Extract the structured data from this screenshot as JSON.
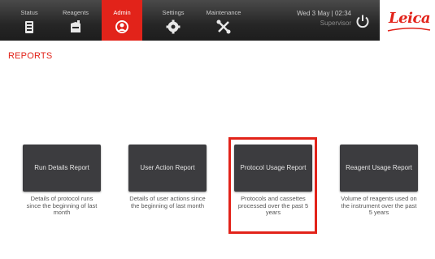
{
  "toolbar": {
    "tabs": [
      {
        "label": "Status",
        "icon": "status-icon"
      },
      {
        "label": "Reagents",
        "icon": "reagents-icon"
      },
      {
        "label": "Admin",
        "icon": "admin-icon",
        "active": true
      },
      {
        "label": "Settings",
        "icon": "settings-gear-icon"
      },
      {
        "label": "Maintenance",
        "icon": "maintenance-tools-icon"
      }
    ],
    "datetime": "Wed 3 May | 02:34",
    "user_role": "Supervisor",
    "power_icon": "power-icon",
    "logo_text": "Leica"
  },
  "page": {
    "title": "REPORTS"
  },
  "reports": [
    {
      "button_label": "Run Details Report",
      "description": "Details of protocol runs since the beginning of last month"
    },
    {
      "button_label": "User Action Report",
      "description": "Details of user actions since the beginning of last month"
    },
    {
      "button_label": "Protocol Usage Report",
      "description": "Protocols and cassettes processed over the past 5 years",
      "highlighted": true
    },
    {
      "button_label": "Reagent Usage Report",
      "description": "Volume of reagents used on the instrument over the past 5 years"
    }
  ],
  "colors": {
    "accent": "#e2231a",
    "toolbar": "#262626",
    "button": "#3c3c3f",
    "text_muted": "#555555"
  }
}
